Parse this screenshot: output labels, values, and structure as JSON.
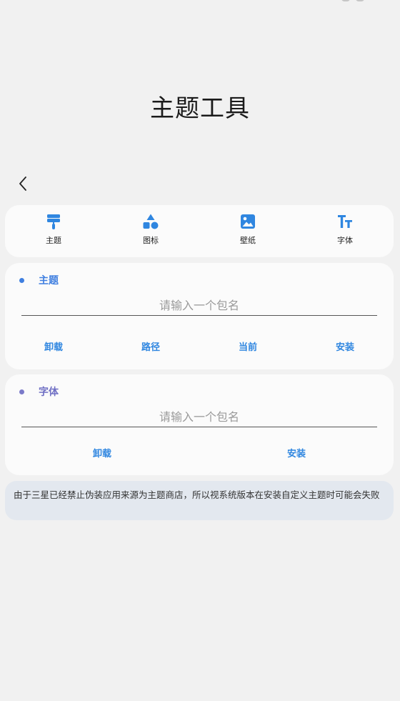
{
  "header": {
    "title": "主题工具"
  },
  "tabs": [
    {
      "label": "主题",
      "icon": "paint-roller-icon"
    },
    {
      "label": "图标",
      "icon": "shapes-icon"
    },
    {
      "label": "壁纸",
      "icon": "image-icon"
    },
    {
      "label": "字体",
      "icon": "font-size-icon"
    }
  ],
  "theme_section": {
    "title": "主题",
    "placeholder": "请输入一个包名",
    "buttons": [
      "卸载",
      "路径",
      "当前",
      "安装"
    ]
  },
  "font_section": {
    "title": "字体",
    "placeholder": "请输入一个包名",
    "buttons": [
      "卸载",
      "安装"
    ]
  },
  "notice": "由于三星已经禁止伪装应用来源为主题商店，所以视系统版本在安装自定义主题时可能会失败",
  "colors": {
    "accent_blue": "#2f86e0",
    "theme_dot": "#3f7fe0",
    "theme_title": "#3f7fe0",
    "font_dot": "#7b7ac9",
    "font_title": "#6f6fc4",
    "background": "#f1f1f1",
    "card": "#fbfbfb",
    "notice_bg": "#e3e8ef"
  }
}
